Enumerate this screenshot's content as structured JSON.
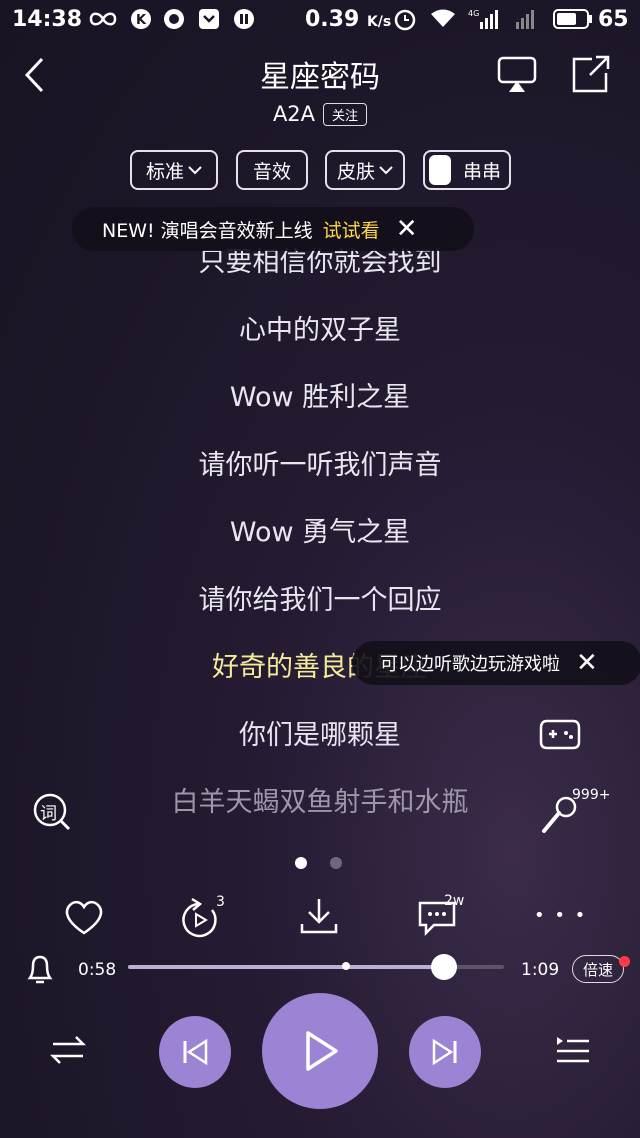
{
  "status_bar": {
    "time": "14:38",
    "speed_value": "0.39",
    "speed_unit": "K/s",
    "battery": "65"
  },
  "header": {
    "title": "星座密码",
    "artist": "A2A",
    "follow_label": "关注"
  },
  "controls": {
    "quality_label": "标准",
    "effect_label": "音效",
    "skin_label": "皮肤",
    "chuan_label": "串串"
  },
  "toast": {
    "text": "NEW! 演唱会音效新上线",
    "action": "试试看",
    "close": "✕"
  },
  "lyrics": {
    "lines": [
      "只要相信你就会找到",
      "心中的双子星",
      "Wow 胜利之星",
      "请你听一听我们声音",
      "Wow 勇气之星",
      "请你给我们一个回应",
      "好奇的善良的星座",
      "你们是哪颗星",
      "白羊天蝎双鱼射手和水瓶"
    ],
    "current_index": 6
  },
  "game_tip": {
    "text": "可以边听歌边玩游戏啦",
    "close": "✕"
  },
  "side": {
    "lyric_icon_char": "词",
    "karaoke_badge": "999+"
  },
  "pager": {
    "pages": 2,
    "active": 0
  },
  "actions": {
    "replay_count": "3",
    "comment_count": "2w",
    "more": "• • •"
  },
  "progress": {
    "elapsed": "0:58",
    "total": "1:09",
    "played_fraction": 0.84,
    "buffered_fraction": 0.58,
    "speed_label": "倍速"
  },
  "colors": {
    "accent": "#9b84d4",
    "current_lyric": "#f5ea9a",
    "highlight": "#ffd84a",
    "badge_red": "#ff3b4a"
  }
}
